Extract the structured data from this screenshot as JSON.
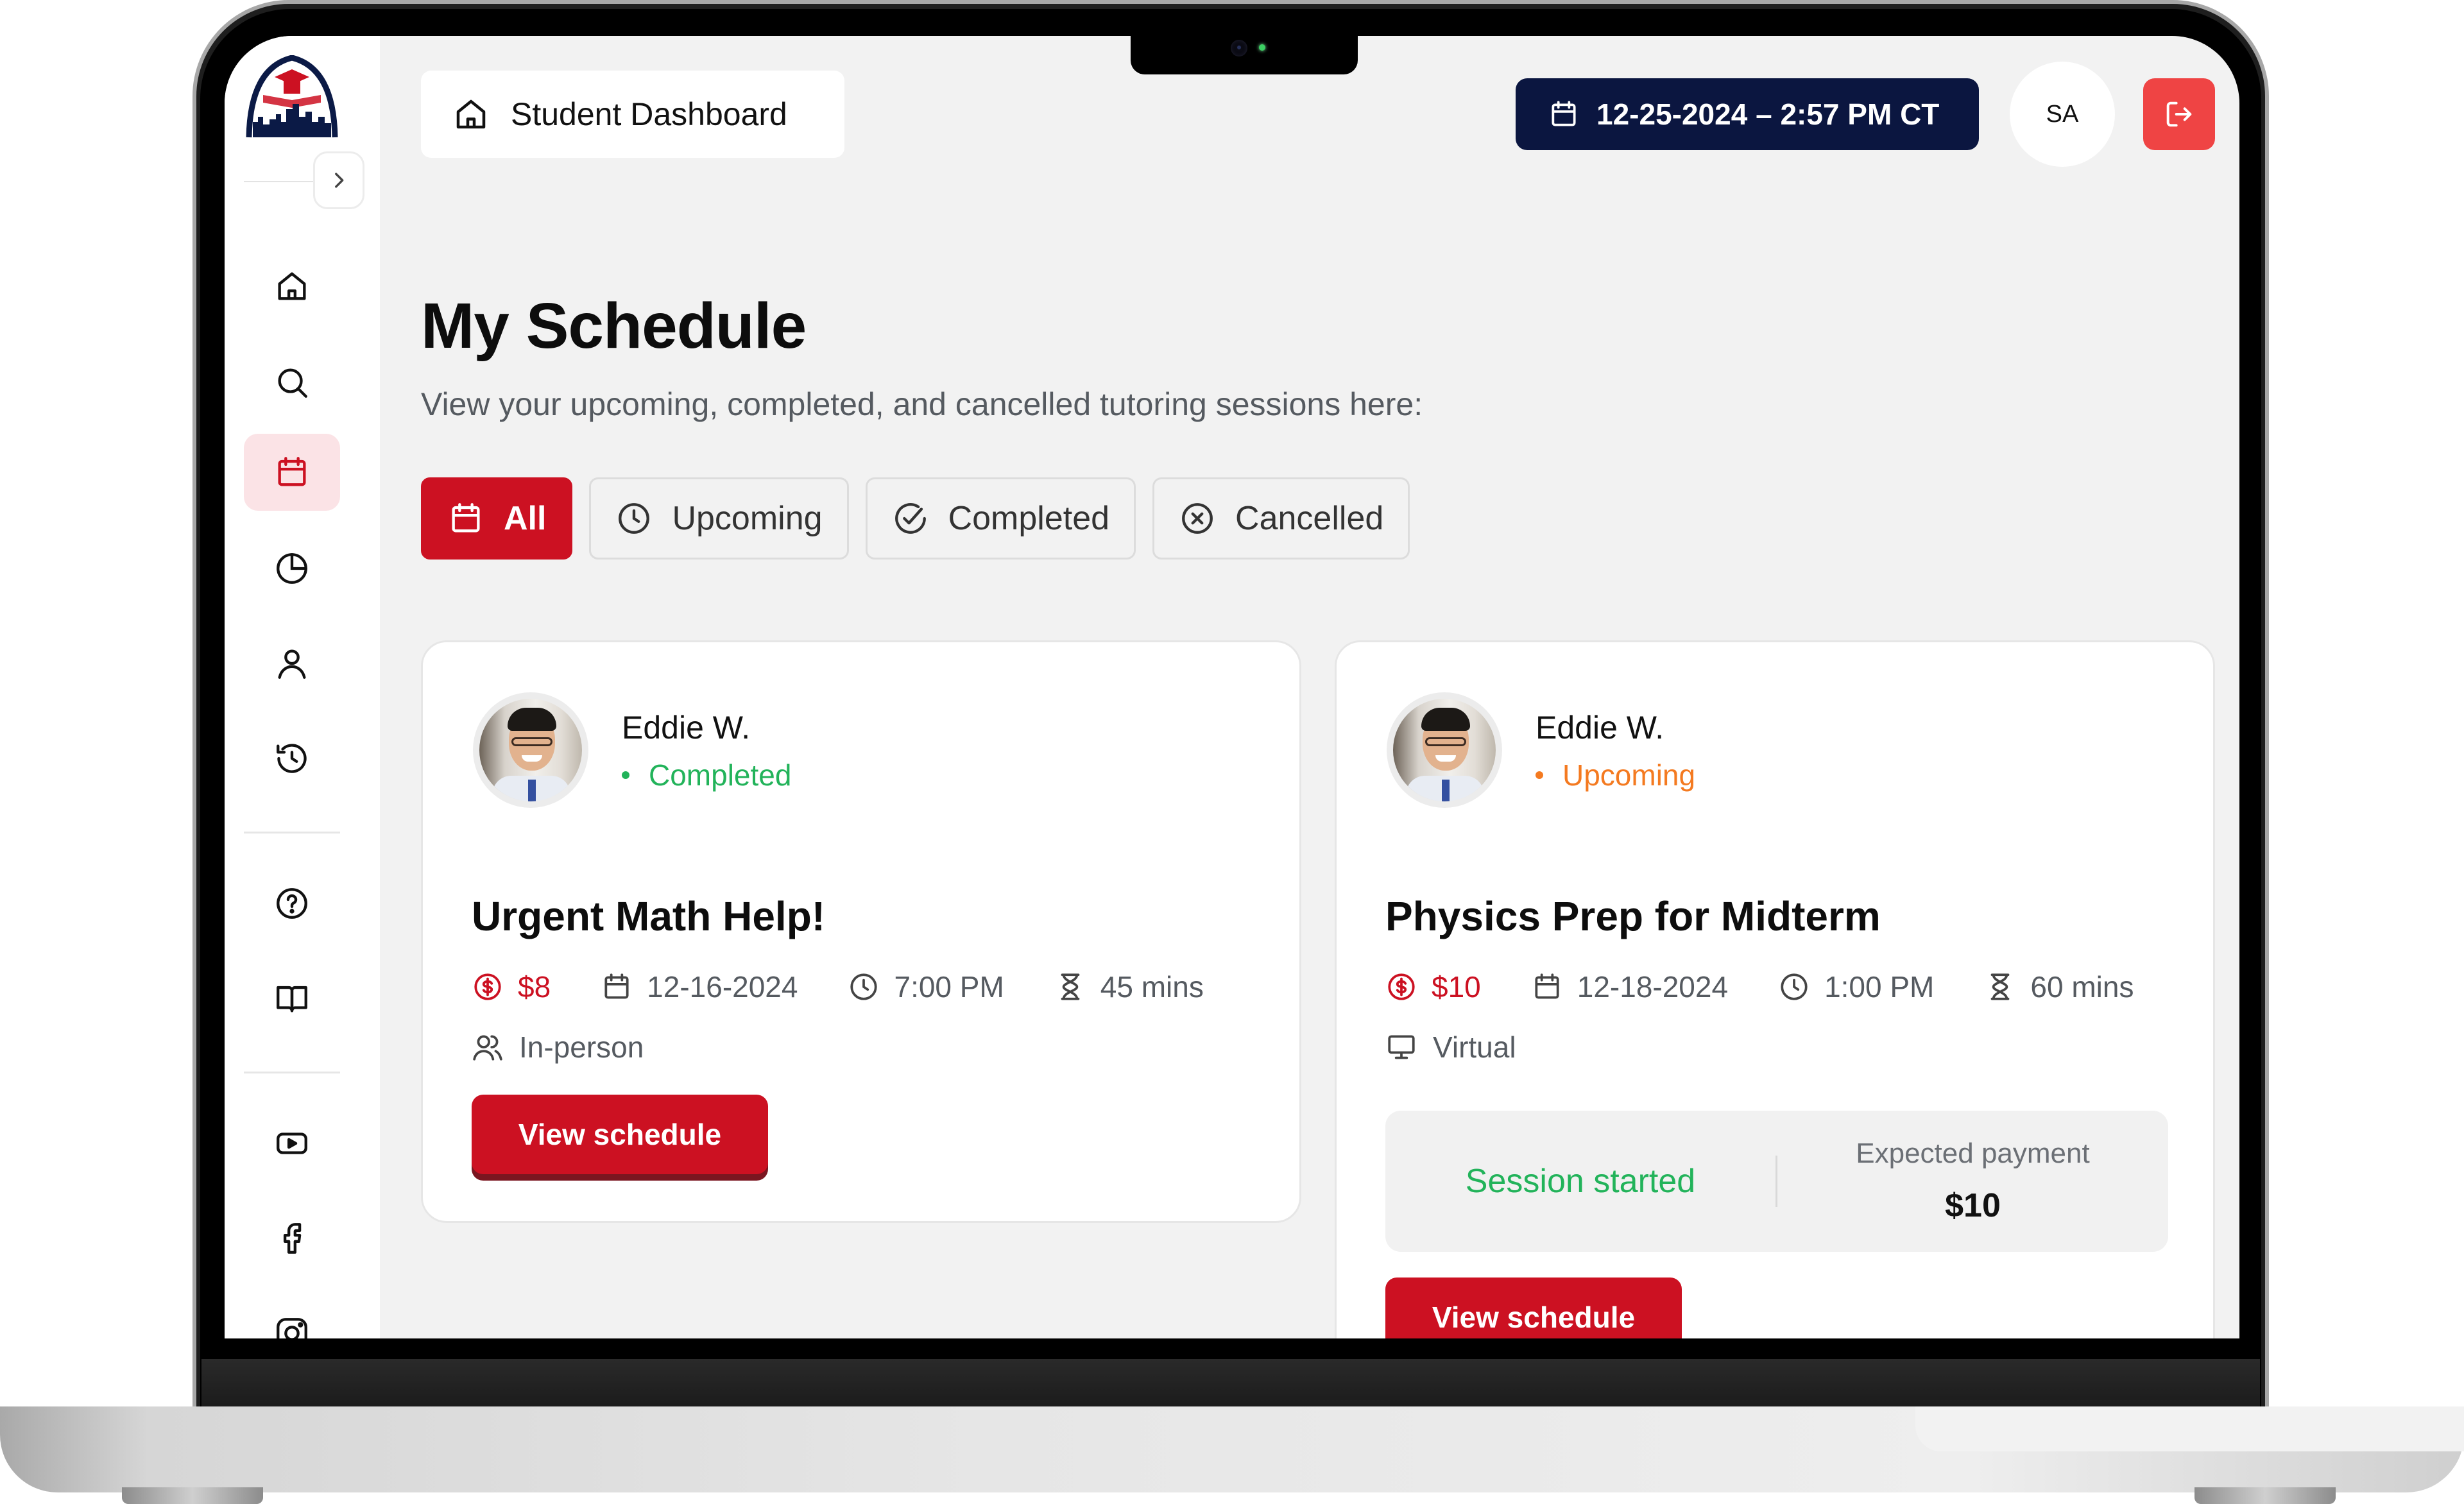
{
  "header": {
    "breadcrumb": {
      "icon": "home-icon",
      "label": "Student Dashboard"
    },
    "datetime": {
      "icon": "calendar-icon",
      "label": "12-25-2024 – 2:57 PM CT"
    },
    "user_initials": "SA",
    "logout_icon": "logout-icon"
  },
  "sidebar": {
    "logo": "arch-graduation-cap-logo",
    "collapse_icon": "chevron-right-icon",
    "items": [
      {
        "name": "home",
        "icon": "home-icon",
        "active": false
      },
      {
        "name": "search",
        "icon": "search-icon",
        "active": false
      },
      {
        "name": "schedule",
        "icon": "calendar-icon",
        "active": true
      },
      {
        "name": "analytics",
        "icon": "pie-chart-icon",
        "active": false
      },
      {
        "name": "profile",
        "icon": "user-icon",
        "active": false
      },
      {
        "name": "history",
        "icon": "history-icon",
        "active": false
      },
      {
        "name": "help",
        "icon": "help-circle-icon",
        "active": false
      },
      {
        "name": "guide",
        "icon": "book-open-icon",
        "active": false
      },
      {
        "name": "youtube",
        "icon": "youtube-icon",
        "active": false
      },
      {
        "name": "facebook",
        "icon": "facebook-icon",
        "active": false
      },
      {
        "name": "instagram",
        "icon": "instagram-icon",
        "active": false
      }
    ]
  },
  "main": {
    "title": "My Schedule",
    "subtitle": "View your upcoming, completed, and cancelled tutoring sessions here:",
    "tabs": [
      {
        "label": "All",
        "icon": "calendar-icon",
        "active": true
      },
      {
        "label": "Upcoming",
        "icon": "clock-icon",
        "active": false
      },
      {
        "label": "Completed",
        "icon": "check-circle-icon",
        "active": false
      },
      {
        "label": "Cancelled",
        "icon": "x-circle-icon",
        "active": false
      }
    ],
    "sessions": [
      {
        "tutor": "Eddie W.",
        "status": "Completed",
        "title": "Urgent Math Help!",
        "price": "$8",
        "date": "12-16-2024",
        "time": "7:00 PM",
        "duration": "45 mins",
        "mode": "In-person",
        "mode_icon": "users-icon",
        "button": "View schedule"
      },
      {
        "tutor": "Eddie W.",
        "status": "Upcoming",
        "title": "Physics Prep for Midterm",
        "price": "$10",
        "date": "12-18-2024",
        "time": "1:00 PM",
        "duration": "60 mins",
        "mode": "Virtual",
        "mode_icon": "monitor-icon",
        "session_state": "Session started",
        "expected_payment_label": "Expected payment",
        "expected_payment_value": "$10",
        "button": "View schedule"
      }
    ]
  },
  "colors": {
    "brand_red": "#cc1122",
    "navy": "#0b1640",
    "completed_green": "#22b35a",
    "upcoming_orange": "#f47a20",
    "logout_red": "#ef4444",
    "active_nav_bg": "#fbe3e6"
  }
}
